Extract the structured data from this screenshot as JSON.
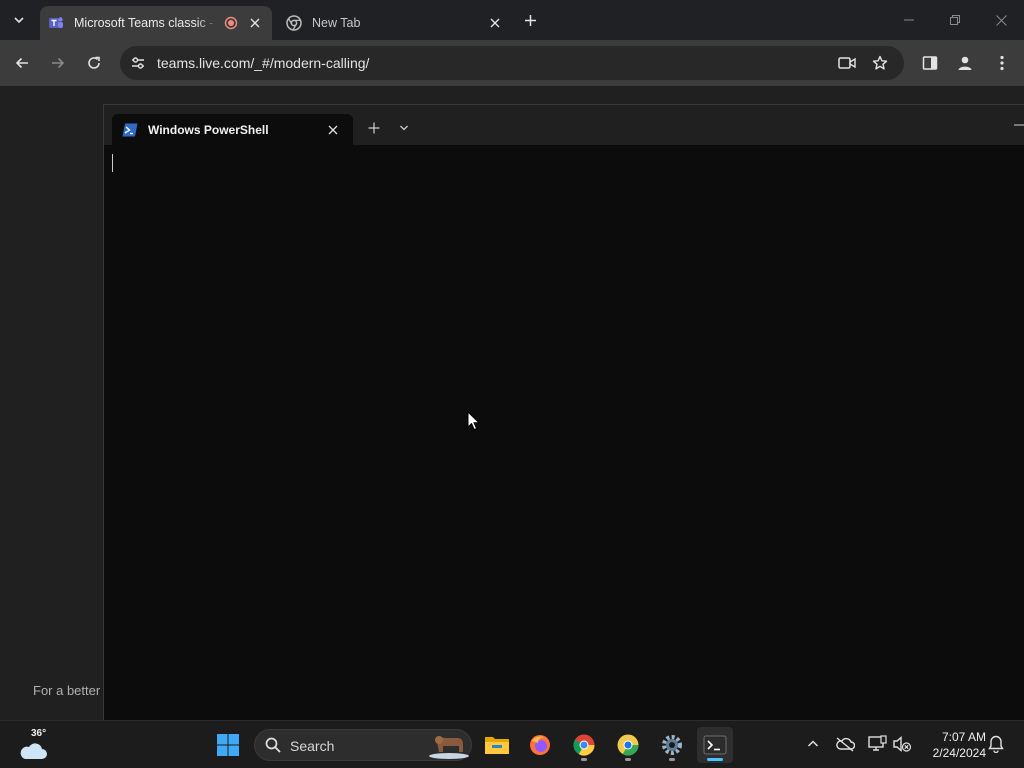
{
  "browser": {
    "tabs": [
      {
        "title": "Microsoft Teams classic - lo",
        "active": true
      },
      {
        "title": "New Tab",
        "active": false
      }
    ],
    "url": "teams.live.com/_#/modern-calling/"
  },
  "page": {
    "hint_text": "For a better"
  },
  "terminal": {
    "tab_title": "Windows PowerShell"
  },
  "taskbar": {
    "weather_temp": "36°",
    "search_label": "Search",
    "clock_time": "7:07 AM",
    "clock_date": "2/24/2024",
    "icons": [
      "start-icon",
      "search-icon",
      "file-explorer-icon",
      "firefox-icon",
      "chrome-icon",
      "chrome-canary-icon",
      "settings-icon",
      "terminal-icon"
    ]
  },
  "colors": {
    "accent": "#4cc2ff",
    "teams_purple": "#5b5fc7",
    "record_red": "#f28b82"
  }
}
